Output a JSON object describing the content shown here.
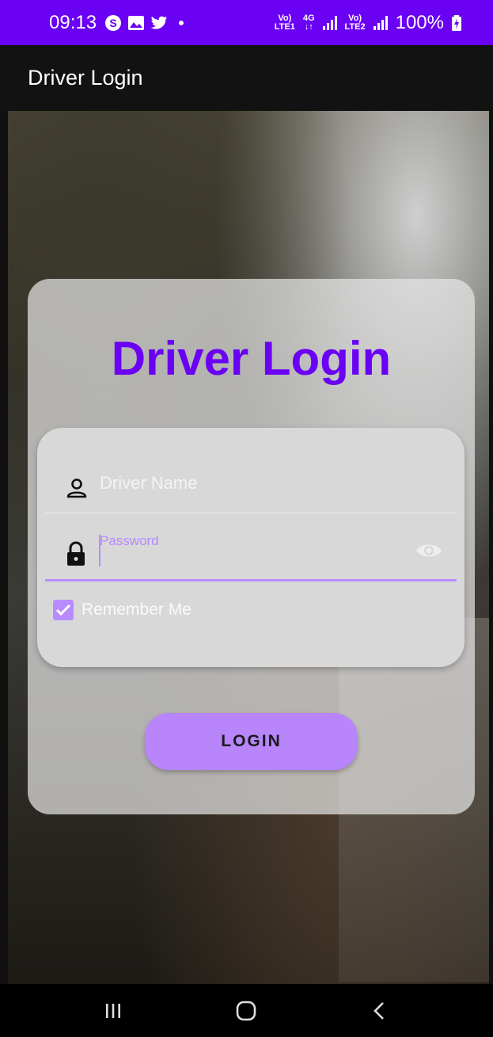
{
  "status_bar": {
    "time": "09:13",
    "notification_icons": [
      "skype-icon",
      "image-icon",
      "twitter-icon",
      "dot-icon"
    ],
    "sim1_label_top": "Vo)",
    "sim1_label_bottom": "LTE1",
    "network_type": "4G",
    "sim2_label_top": "Vo)",
    "sim2_label_bottom": "LTE2",
    "battery_percent": "100%",
    "background_color": "#6a00f4"
  },
  "app_bar": {
    "title": "Driver Login"
  },
  "login_card": {
    "title": "Driver Login",
    "title_color": "#6a00f4",
    "name_field": {
      "placeholder": "Driver Name",
      "value": "",
      "icon": "person-icon"
    },
    "password_field": {
      "label": "Password",
      "value": "",
      "icon": "lock-icon",
      "toggle_icon": "eye-icon",
      "focused": true
    },
    "remember_me": {
      "label": "Remember Me",
      "checked": true
    },
    "login_button": {
      "label": "LOGIN",
      "color": "#b885fb"
    }
  },
  "nav_bar": {
    "buttons": [
      "recents-icon",
      "home-icon",
      "back-icon"
    ]
  }
}
